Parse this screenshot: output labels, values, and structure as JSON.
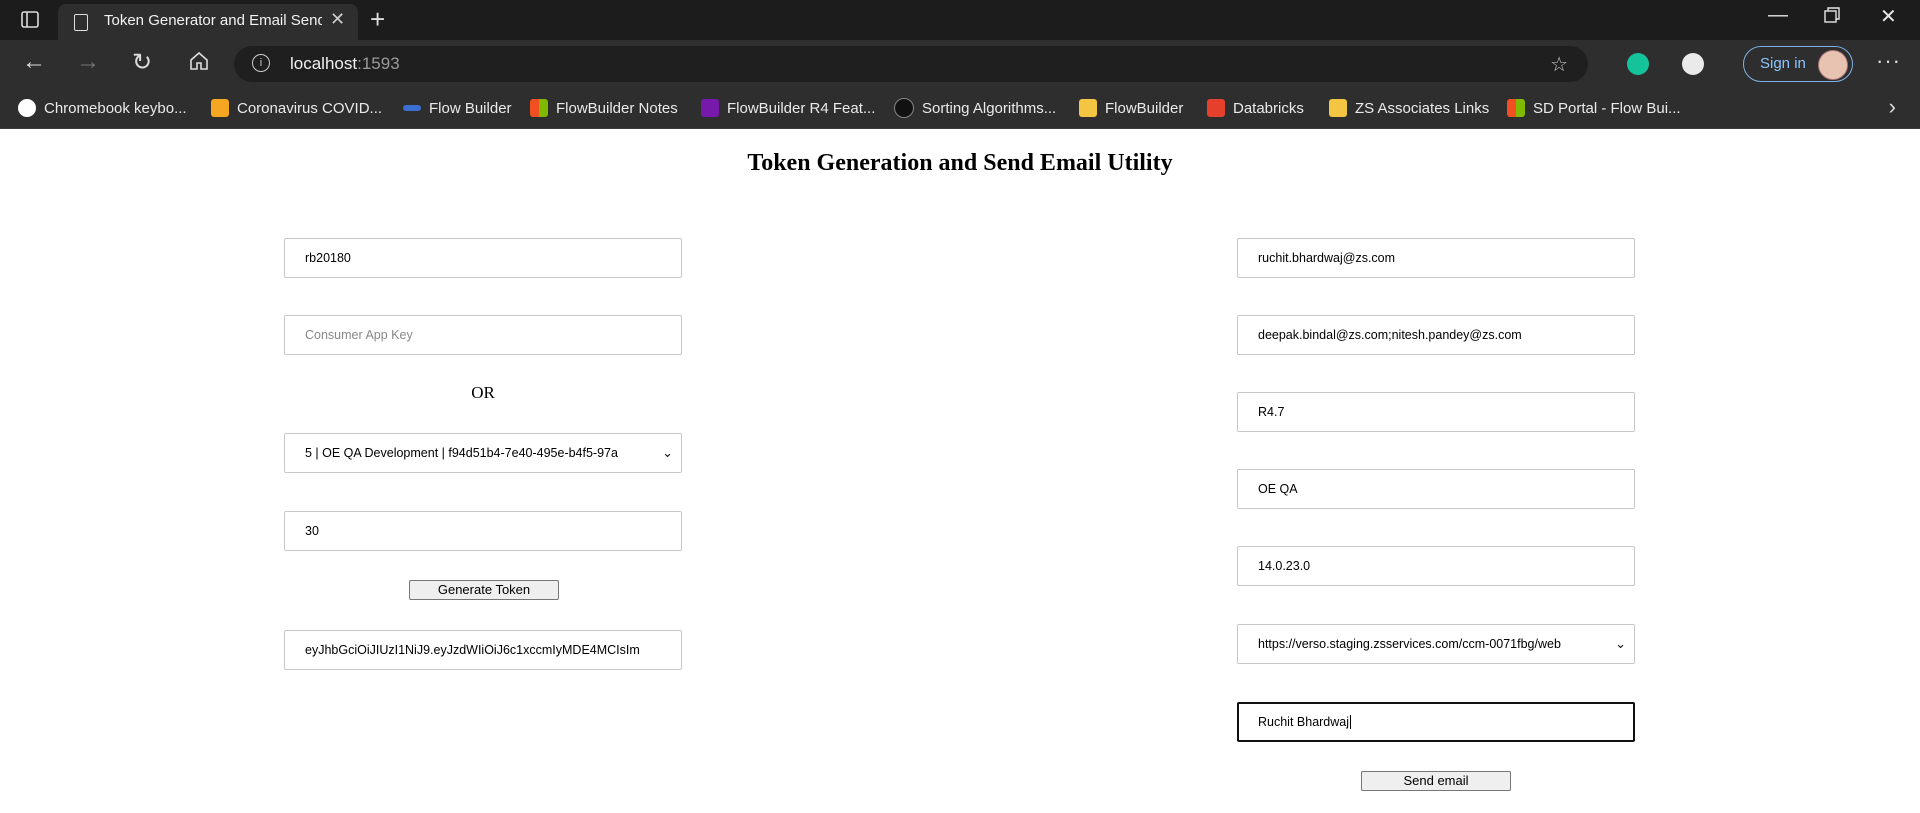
{
  "browser": {
    "tab_title": "Token Generator and Email Send",
    "url_host": "localhost",
    "url_port": ":1593",
    "signin_label": "Sign in",
    "bookmarks": [
      {
        "label": "Chromebook keybo...",
        "icon": "google-icon",
        "color": "#ffffff"
      },
      {
        "label": "Coronavirus COVID...",
        "icon": "covid-icon",
        "color": "#f5a623"
      },
      {
        "label": "Flow Builder",
        "icon": "flow-icon",
        "color": "#3b6fd1"
      },
      {
        "label": "FlowBuilder Notes",
        "icon": "microsoft-icon",
        "color": "#f25022"
      },
      {
        "label": "FlowBuilder R4 Feat...",
        "icon": "onenote-icon",
        "color": "#7719aa"
      },
      {
        "label": "Sorting Algorithms...",
        "icon": "github-icon",
        "color": "#111111"
      },
      {
        "label": "FlowBuilder",
        "icon": "folder-icon",
        "color": "#f4c542"
      },
      {
        "label": "Databricks",
        "icon": "databricks-icon",
        "color": "#e5402c"
      },
      {
        "label": "ZS Associates Links",
        "icon": "folder-icon",
        "color": "#f4c542"
      },
      {
        "label": "SD Portal - Flow Bui...",
        "icon": "microsoft-icon",
        "color": "#f25022"
      }
    ]
  },
  "page": {
    "title": "Token Generation and Send Email Utility",
    "left": {
      "user_id": "rb20180",
      "consumer_key_placeholder": "Consumer App Key",
      "or_label": "OR",
      "app_select": "5 | OE QA Development | f94d51b4-7e40-495e-b4f5-97a",
      "days": "30",
      "generate_label": "Generate Token",
      "token": "eyJhbGciOiJIUzI1NiJ9.eyJzdWIiOiJ6c1xccmIyMDE4MCIsIm"
    },
    "right": {
      "to_email": "ruchit.bhardwaj@zs.com",
      "cc_email": "deepak.bindal@zs.com;nitesh.pandey@zs.com",
      "release": "R4.7",
      "environment": "OE QA",
      "version": "14.0.23.0",
      "url_select": "https://verso.staging.zsservices.com/ccm-0071fbg/web",
      "sender_name": "Ruchit Bhardwaj",
      "send_label": "Send email"
    }
  }
}
